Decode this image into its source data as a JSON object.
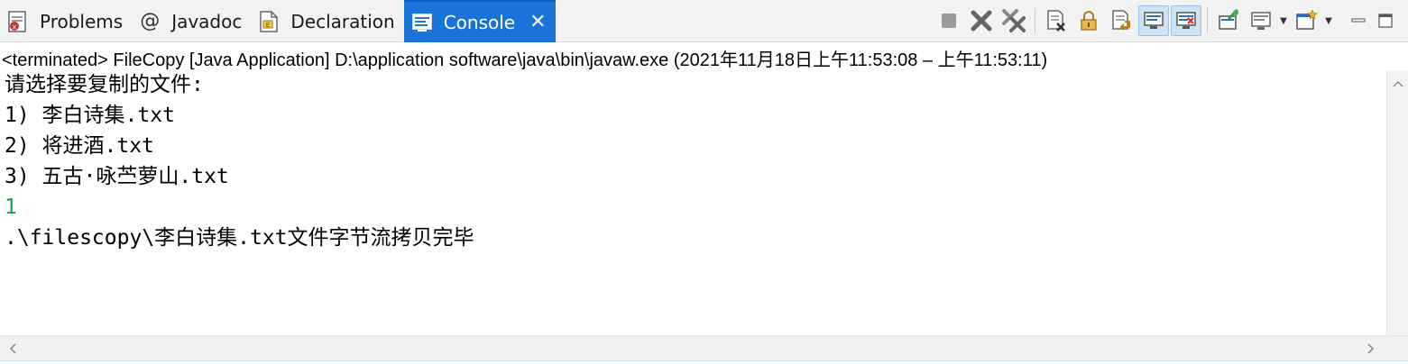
{
  "tabs": [
    {
      "label": "Problems",
      "icon": "problems-icon",
      "active": false
    },
    {
      "label": "Javadoc",
      "icon": "at-sign-icon",
      "active": false
    },
    {
      "label": "Declaration",
      "icon": "declaration-icon",
      "active": false
    },
    {
      "label": "Console",
      "icon": "console-icon",
      "active": true
    }
  ],
  "toolbar": {
    "icons": [
      "terminate-icon",
      "remove-launch-icon",
      "remove-all-terminated-icon",
      "clear-console-icon",
      "scroll-lock-icon",
      "word-wrap-icon",
      "show-on-stdout-icon",
      "show-on-stderr-icon",
      "pin-console-icon",
      "display-selected-console-icon",
      "open-console-icon",
      "minimize-icon",
      "maximize-icon"
    ]
  },
  "status": {
    "text": "<terminated> FileCopy [Java Application] D:\\application software\\java\\bin\\javaw.exe  (2021年11月18日上午11:53:08 – 上午11:53:11)"
  },
  "console": {
    "lines": [
      {
        "text": "请选择要复制的文件:",
        "type": "stdout"
      },
      {
        "text": "1) 李白诗集.txt",
        "type": "stdout"
      },
      {
        "text": "2) 将进酒.txt",
        "type": "stdout"
      },
      {
        "text": "3) 五古·咏苎萝山.txt",
        "type": "stdout"
      },
      {
        "text": "1",
        "type": "stdin"
      },
      {
        "text": ".\\filescopy\\李白诗集.txt文件字节流拷贝完毕",
        "type": "stdout"
      }
    ]
  },
  "colors": {
    "active_tab": "#1a73d9",
    "stdin_text": "#10a34e",
    "stdout_text": "#000000"
  }
}
